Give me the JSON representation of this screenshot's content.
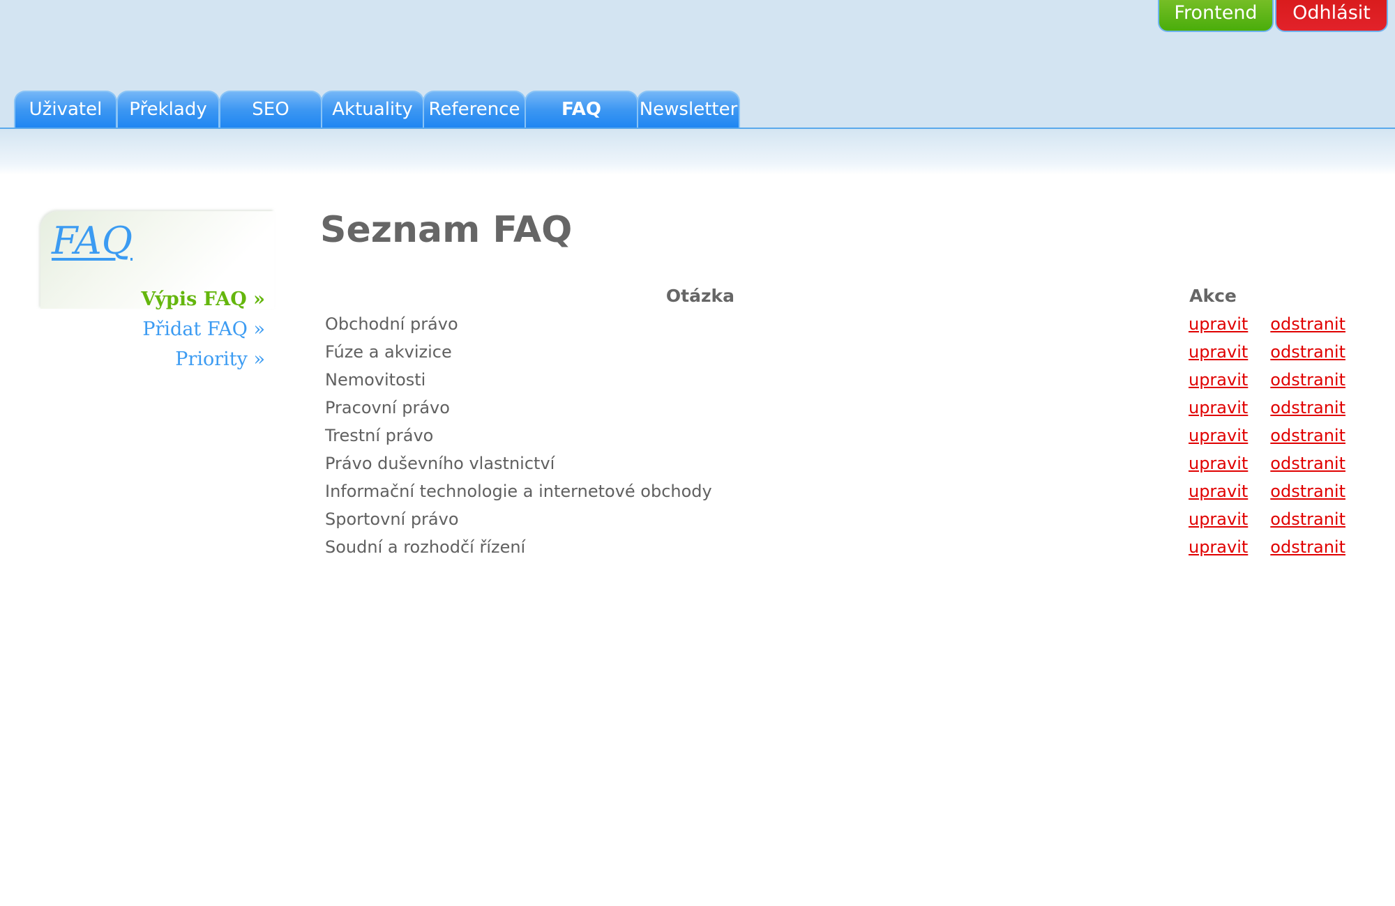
{
  "header": {
    "buttons": {
      "frontend": "Frontend",
      "logout": "Odhlásit"
    },
    "tabs": [
      {
        "label": "Uživatel",
        "active": false
      },
      {
        "label": "Překlady",
        "active": false
      },
      {
        "label": "SEO",
        "active": false
      },
      {
        "label": "Aktuality",
        "active": false
      },
      {
        "label": "Reference",
        "active": false
      },
      {
        "label": "FAQ",
        "active": true
      },
      {
        "label": "Newsletter",
        "active": false
      }
    ]
  },
  "sidebar": {
    "title": "FAQ",
    "items": [
      {
        "label": "Výpis FAQ »",
        "active": true
      },
      {
        "label": "Přidat FAQ »",
        "active": false
      },
      {
        "label": "Priority »",
        "active": false
      }
    ]
  },
  "main": {
    "title": "Seznam FAQ",
    "columns": {
      "question": "Otázka",
      "actions": "Akce"
    },
    "action_labels": {
      "edit": "upravit",
      "delete": "odstranit"
    },
    "rows": [
      {
        "question": "Obchodní právo"
      },
      {
        "question": "Fúze a akvizice"
      },
      {
        "question": "Nemovitosti"
      },
      {
        "question": "Pracovní právo"
      },
      {
        "question": "Trestní právo"
      },
      {
        "question": "Právo duševního vlastnictví"
      },
      {
        "question": "Informační technologie a internetové obchody"
      },
      {
        "question": "Sportovní právo"
      },
      {
        "question": "Soudní a rozhodčí řízení"
      }
    ]
  },
  "colors": {
    "tab_blue": "#1f86f2",
    "header_bg": "#d3e4f2",
    "frontend_green": "#4aad0b",
    "logout_red": "#e2222a",
    "link_red": "#e00000",
    "sidebar_active_green": "#64b60d",
    "sidebar_link_blue": "#3b9bf2",
    "text_gray": "#666666"
  }
}
